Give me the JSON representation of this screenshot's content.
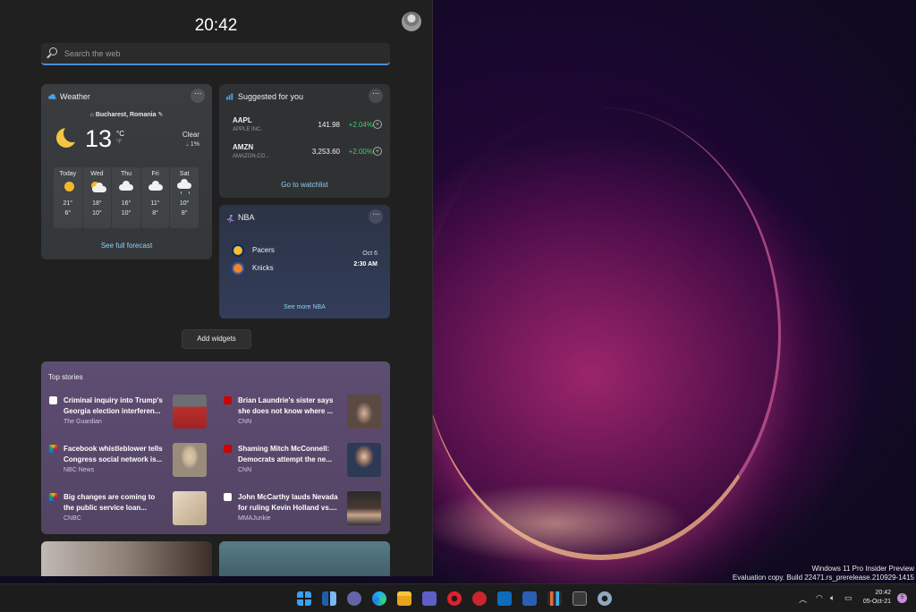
{
  "panel": {
    "clock": "20:42",
    "search": {
      "placeholder": "Search the web"
    },
    "add_widgets": "Add widgets"
  },
  "weather": {
    "title": "Weather",
    "location": "Bucharest, Romania",
    "temp": "13",
    "unit_c": "°C",
    "unit_f": "°F",
    "condition": "Clear",
    "precip": "1%",
    "forecast": [
      {
        "day": "Today",
        "icon": "sun-icon",
        "high": "21°",
        "low": "6°"
      },
      {
        "day": "Wed",
        "icon": "partly-cloudy-icon",
        "high": "18°",
        "low": "10°"
      },
      {
        "day": "Thu",
        "icon": "cloud-icon",
        "high": "16°",
        "low": "10°"
      },
      {
        "day": "Fri",
        "icon": "cloud-icon",
        "high": "11°",
        "low": "8°"
      },
      {
        "day": "Sat",
        "icon": "rain-cloud-icon",
        "high": "10°",
        "low": "8°"
      }
    ],
    "link": "See full forecast"
  },
  "stocks": {
    "title": "Suggested for you",
    "items": [
      {
        "symbol": "AAPL",
        "name": "APPLE INC.",
        "price": "141.98",
        "change": "+2.04%"
      },
      {
        "symbol": "AMZN",
        "name": "AMAZON.CO...",
        "price": "3,253.60",
        "change": "+2.00%"
      }
    ],
    "link": "Go to watchlist"
  },
  "nba": {
    "title": "NBA",
    "team1": "Pacers",
    "team2": "Knicks",
    "date": "Oct 6",
    "time": "2:30 AM",
    "link": "See more NBA"
  },
  "top_stories": {
    "title": "Top stories",
    "items": [
      {
        "headline": "Criminal inquiry into Trump's Georgia election interferen...",
        "source": "The Guardian"
      },
      {
        "headline": "Brian Laundrie's sister says she does not know where ...",
        "source": "CNN"
      },
      {
        "headline": "Facebook whistleblower tells Congress social network is...",
        "source": "NBC News"
      },
      {
        "headline": "Shaming Mitch McConnell: Democrats attempt the ne...",
        "source": "CNN"
      },
      {
        "headline": "Big changes are coming to the public service loan...",
        "source": "CNBC"
      },
      {
        "headline": "John McCarthy lauds Nevada for ruling Kevin Holland vs....",
        "source": "MMAJunkie"
      }
    ]
  },
  "watermark": {
    "line1": "Windows 11 Pro Insider Preview",
    "line2": "Evaluation copy. Build 22471.rs_prerelease.210929-1415"
  },
  "taskbar": {
    "time": "20:42",
    "date": "05-Oct-21",
    "notifications": "5"
  },
  "colors": {
    "accent": "#4c8fd6",
    "link": "#8fd0f0",
    "positive": "#3ecf6a"
  }
}
